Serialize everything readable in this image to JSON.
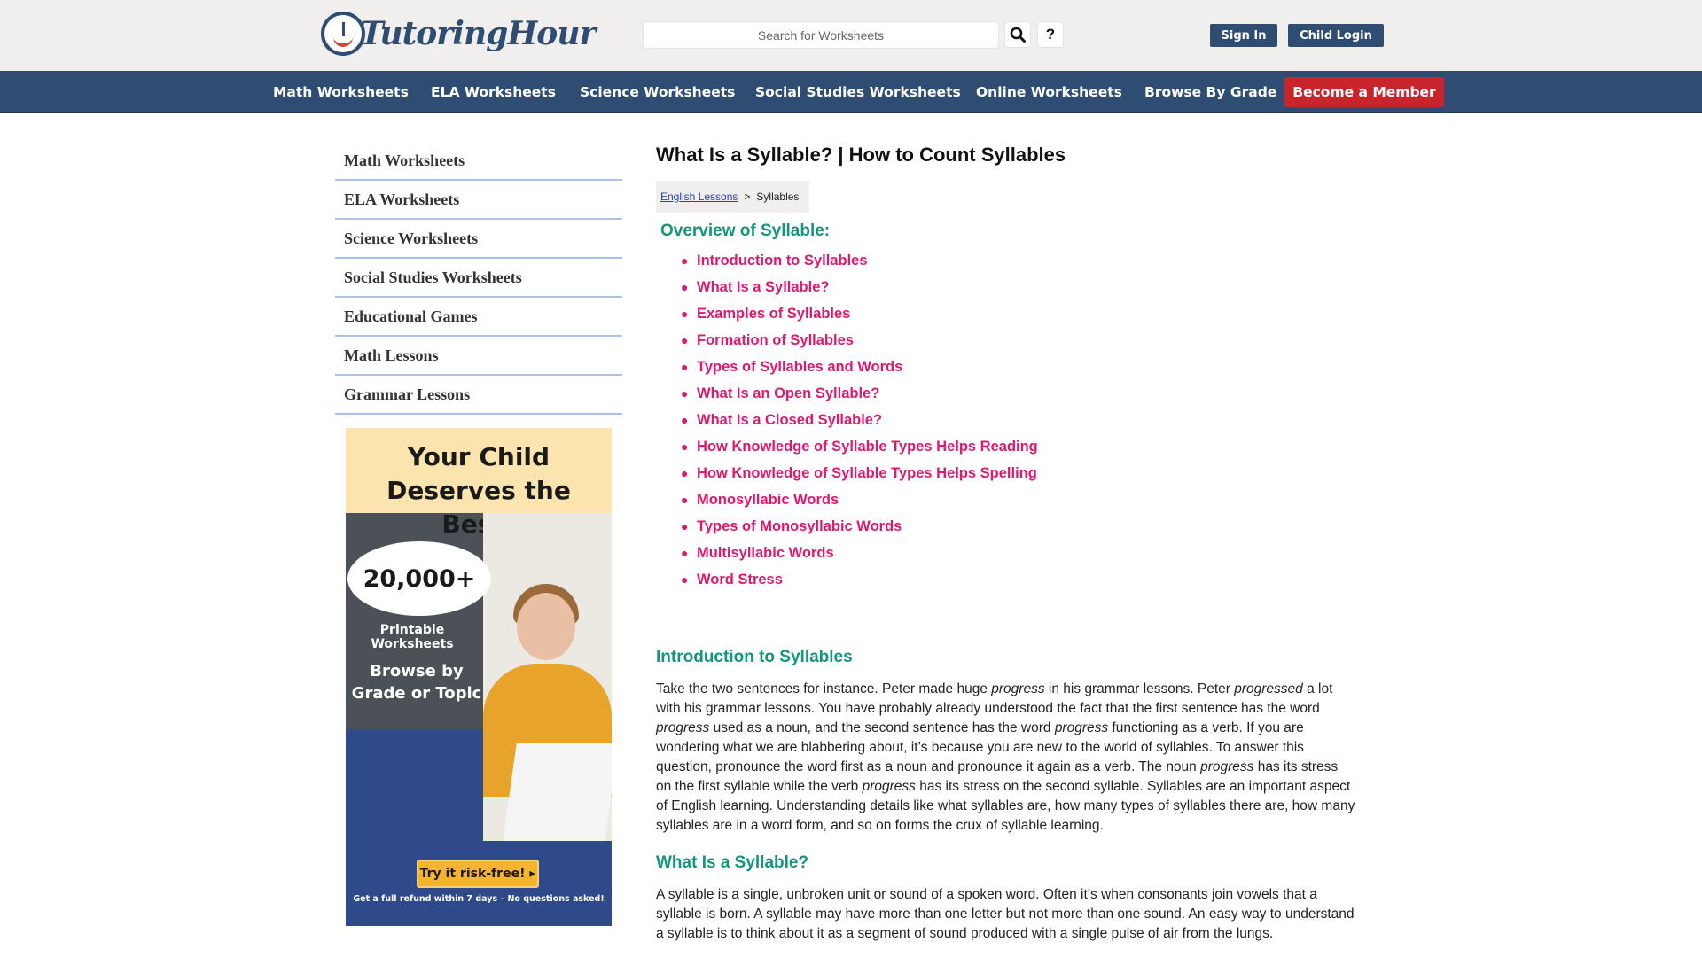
{
  "header": {
    "logo_text_a": "Tutoring",
    "logo_text_b": "Hour",
    "search_placeholder": "Search for Worksheets",
    "help_label": "?",
    "sign_in": "Sign In",
    "child_login": "Child Login"
  },
  "nav": {
    "items": [
      "Math Worksheets",
      "ELA Worksheets",
      "Science Worksheets",
      "Social Studies Worksheets",
      "Online Worksheets",
      "Browse By Grade"
    ],
    "member": "Become a Member"
  },
  "sidebar": {
    "items": [
      "Math Worksheets",
      "ELA Worksheets",
      "Science Worksheets",
      "Social Studies Worksheets",
      "Educational Games",
      "Math Lessons",
      "Grammar Lessons"
    ]
  },
  "promo": {
    "headline_1": "Your Child",
    "headline_2": "Deserves the Best!",
    "count": "20,000+",
    "sub": "Printable Worksheets",
    "browse_1": "Browse by",
    "browse_2": "Grade or Topic",
    "cta": "Try it risk-free! ▸",
    "fine": "Get a full refund within 7 days – No questions asked!"
  },
  "article": {
    "title": "What Is a Syllable? | How to Count Syllables",
    "breadcrumb_link": "English Lessons",
    "breadcrumb_sep": ">",
    "breadcrumb_current": "Syllables",
    "overview_heading": "Overview of Syllable:",
    "toc": [
      "Introduction to Syllables",
      "What Is a Syllable?",
      "Examples of Syllables",
      "Formation of Syllables",
      "Types of Syllables and Words",
      "What Is an Open Syllable?",
      "What Is a Closed Syllable?",
      "How Knowledge of Syllable Types Helps Reading",
      "How Knowledge of Syllable Types Helps Spelling",
      "Monosyllabic Words",
      "Types of Monosyllabic Words",
      "Multisyllabic Words",
      "Word Stress"
    ],
    "intro_heading": "Introduction to Syllables",
    "intro_p": {
      "t1": "Take the two sentences for instance. Peter made huge ",
      "e1": "progress",
      "t2": " in his grammar lessons. Peter ",
      "e2": "progressed",
      "t3": " a lot with his grammar lessons. You have probably already understood the fact that the first sentence has the word ",
      "e3": "progress",
      "t4": " used as a noun, and the second sentence has the word ",
      "e4": "progress",
      "t5": " functioning as a verb. If you are wondering what we are blabbering about, it’s because you are new to the world of syllables. To answer this question, pronounce the word first as a noun and pronounce it again as a verb. The noun ",
      "e5": "progress",
      "t6": " has its stress on the first syllable while the verb ",
      "e6": "progress",
      "t7": " has its stress on the second syllable. Syllables are an important aspect of English learning. Understanding details like what syllables are, how many types of syllables there are, how many syllables are in a word form, and so on forms the crux of syllable learning."
    },
    "what_heading": "What Is a Syllable?",
    "what_p": "A syllable is a single, unbroken unit or sound of a spoken word. Often it’s when consonants join vowels that a syllable is born. A syllable may have more than one letter but not more than one sound. An easy way to understand a syllable is to think about it as a segment of sound produced with a single pulse of air from the lungs."
  },
  "colors": {
    "brand_navy": "#2f4d73",
    "member_red": "#c9242b",
    "heading_green": "#13967a",
    "toc_pink": "#e0186e"
  }
}
